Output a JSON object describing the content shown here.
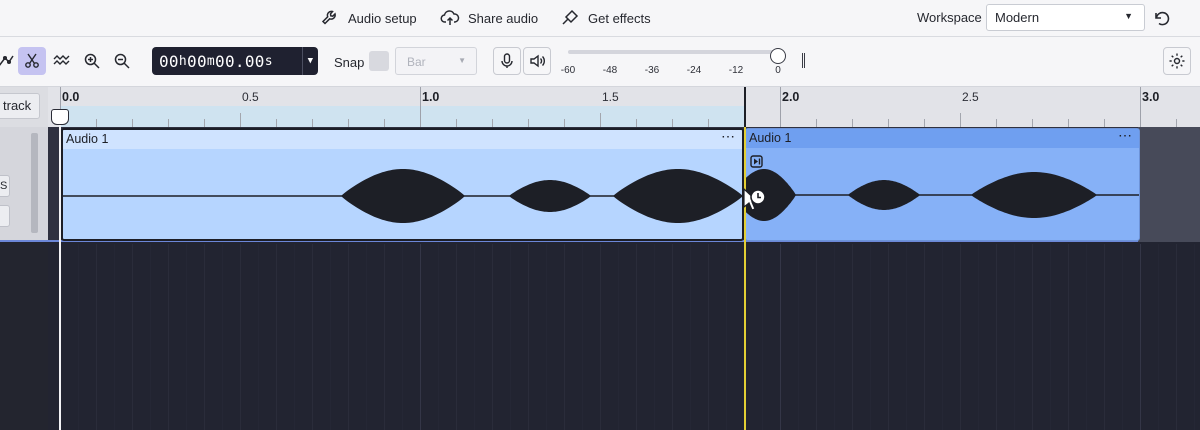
{
  "topbar": {
    "audio_setup": "Audio setup",
    "share_audio": "Share audio",
    "get_effects": "Get effects",
    "workspace_label": "Workspace",
    "workspace_value": "Modern"
  },
  "toolbar": {
    "time_h": "00",
    "time_m": "00",
    "time_s": "00.00",
    "unit_h": "h",
    "unit_m": "m",
    "unit_s": "s",
    "snap_label": "Snap",
    "snap_value": "Bar",
    "meter_ticks": [
      "-60",
      "-48",
      "-36",
      "-24",
      "-12",
      "0"
    ],
    "meter_level": 1.0
  },
  "left_panel": {
    "add_track": "track",
    "solo_label": "S"
  },
  "ruler": {
    "labels": [
      "0.0",
      "0.5",
      "1.0",
      "1.5",
      "2.0",
      "2.5",
      "3.0"
    ]
  },
  "clips": [
    {
      "name": "Audio 1",
      "menu": "⋯"
    },
    {
      "name": "Audio 1",
      "menu": "⋯"
    }
  ],
  "colors": {
    "accent": "#6c87d8",
    "clip_selected": "#b6d5ff",
    "clip_other": "#86b1f7",
    "cursor": "#e3cf34"
  }
}
